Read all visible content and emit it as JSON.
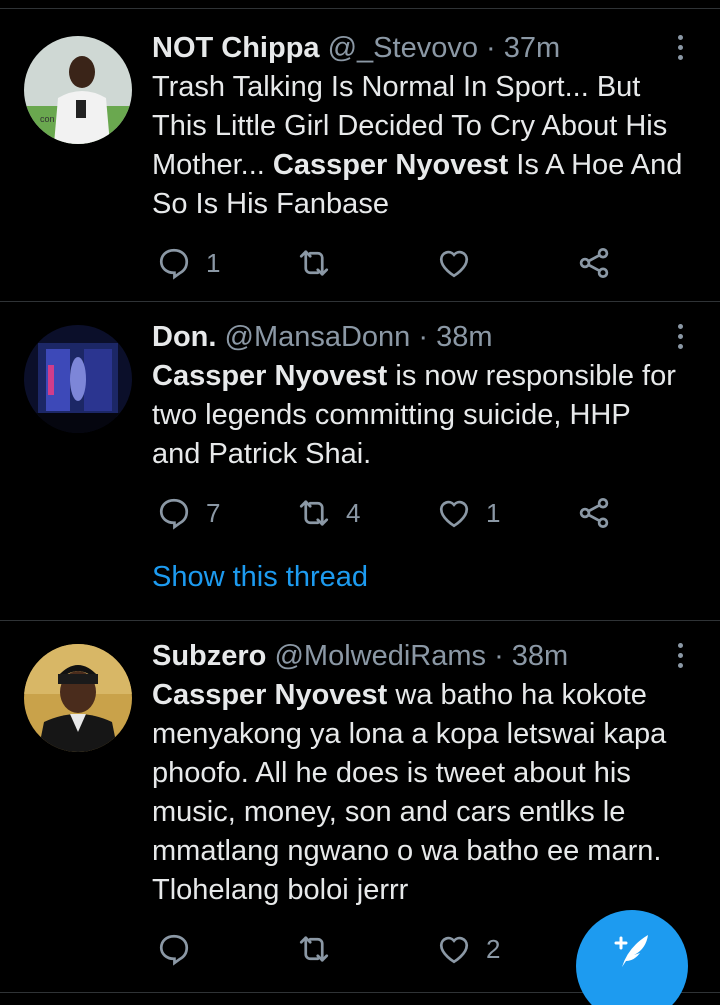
{
  "tweets": [
    {
      "name": "NOT Chippa",
      "handle": "@_Stevovo",
      "time": "· 37m",
      "text_parts": [
        "Trash Talking Is Normal In Sport... But This Little Girl Decided To Cry About His Mother... ",
        "Cassper Nyovest",
        " Is A Hoe And So Is His Fanbase"
      ],
      "replies": "1",
      "retweets": "",
      "likes": ""
    },
    {
      "name": "Don.",
      "handle": "@MansaDonn",
      "time": "· 38m",
      "text_parts": [
        "",
        "Cassper Nyovest",
        " is now responsible for two legends committing suicide, HHP and Patrick Shai."
      ],
      "replies": "7",
      "retweets": "4",
      "likes": "1",
      "thread_link": "Show this thread"
    },
    {
      "name": "Subzero",
      "handle": "@MolwediRams",
      "time": "· 38m",
      "text_parts": [
        "",
        "Cassper Nyovest",
        " wa batho ha kokote menyakong ya lona a kopa letswai kapa phoofo. All he does is tweet about his music, money, son and cars entlks le mmatlang ngwano o wa batho ee marn. Tlohelang boloi jerrr"
      ],
      "replies": "",
      "retweets": "",
      "likes": "2"
    }
  ],
  "icons": {
    "reply": "reply-bubble-icon",
    "retweet": "retweet-icon",
    "like": "heart-icon",
    "share": "share-icon",
    "compose": "compose-tweet-icon",
    "more": "more-vertical-icon"
  },
  "colors": {
    "background": "#000000",
    "text": "#e7e9ea",
    "muted": "#8b98a5",
    "accent": "#1d9bf0",
    "divider": "#2f3336"
  }
}
